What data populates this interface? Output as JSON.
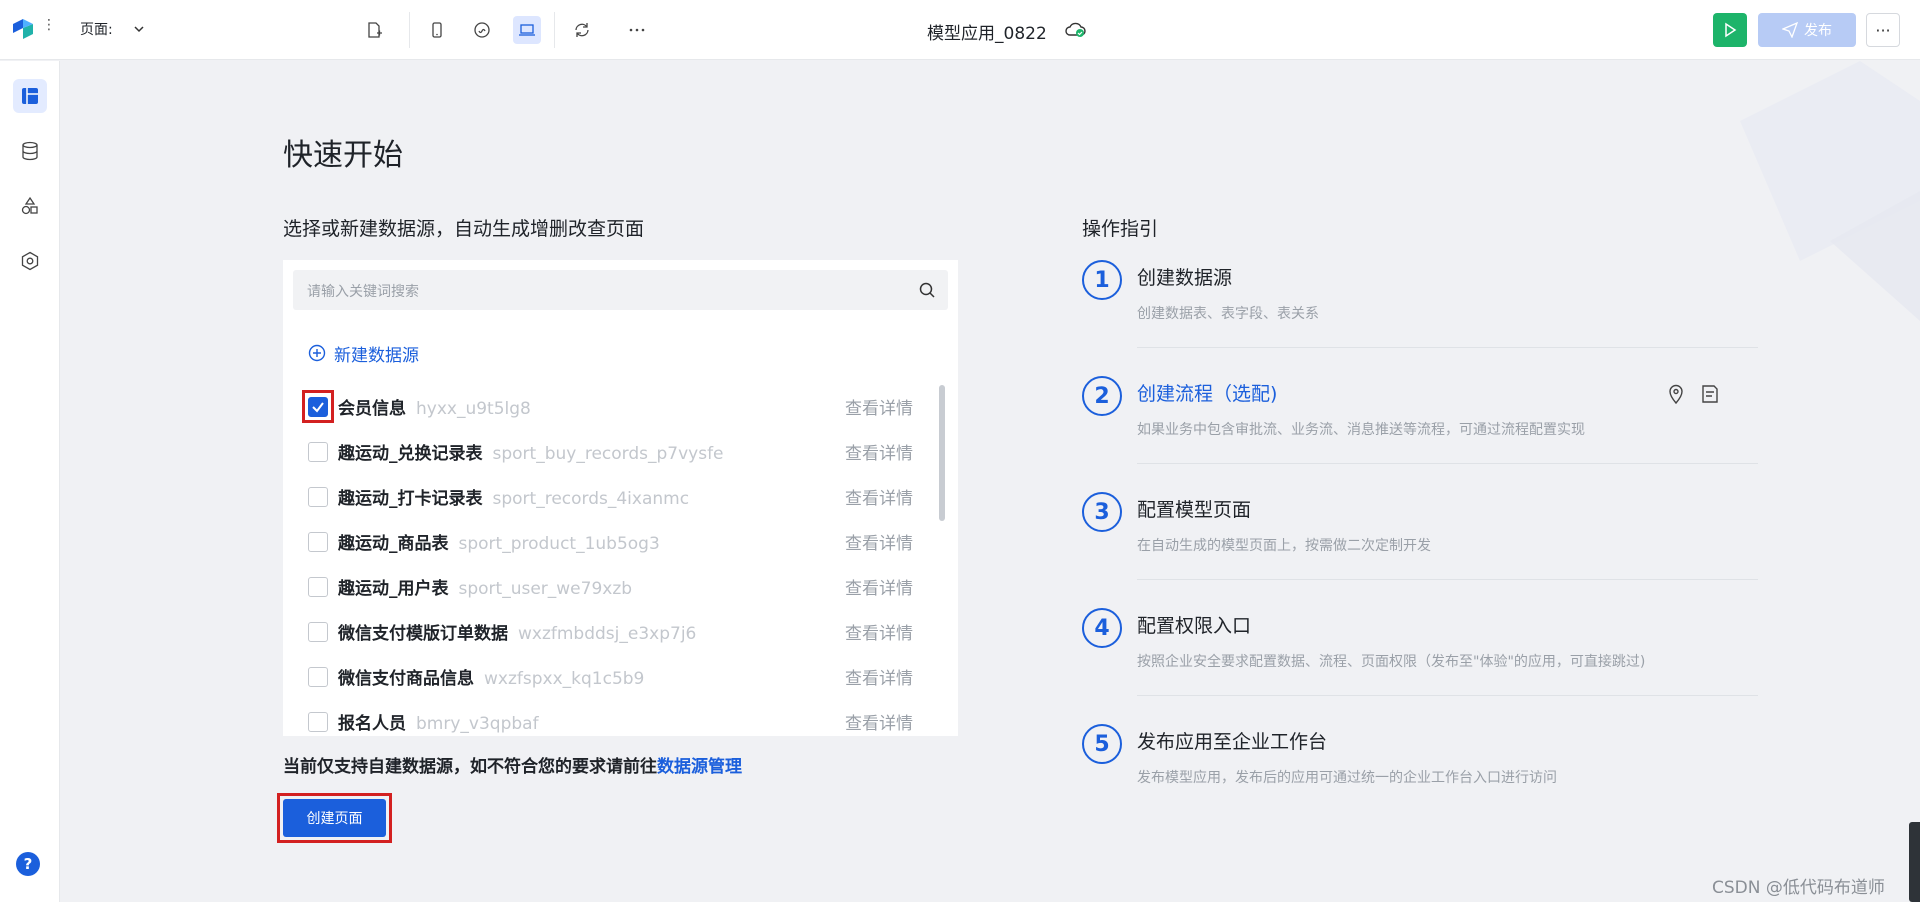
{
  "topbar": {
    "page_label": "页面:",
    "app_title": "模型应用_0822",
    "publish_label": "发布",
    "more_label": "···",
    "colors": {
      "run": "#1db46a",
      "publish": "#b7cbf5",
      "accent": "#1b5fdc"
    }
  },
  "siderail": {
    "items": [
      "page-icon",
      "database-icon",
      "components-icon",
      "settings-hex-icon"
    ],
    "help_label": "?"
  },
  "main": {
    "title": "快速开始",
    "subtitle": "选择或新建数据源，自动生成增删改查页面",
    "search_placeholder": "请输入关键词搜索",
    "new_datasource": "新建数据源",
    "datasources": [
      {
        "name": "会员信息",
        "id": "hyxx_u9t5lg8",
        "detail": "查看详情",
        "checked": true
      },
      {
        "name": "趣运动_兑换记录表",
        "id": "sport_buy_records_p7vysfe",
        "detail": "查看详情",
        "checked": false
      },
      {
        "name": "趣运动_打卡记录表",
        "id": "sport_records_4ixanmc",
        "detail": "查看详情",
        "checked": false
      },
      {
        "name": "趣运动_商品表",
        "id": "sport_product_1ub5og3",
        "detail": "查看详情",
        "checked": false
      },
      {
        "name": "趣运动_用户表",
        "id": "sport_user_we79xzb",
        "detail": "查看详情",
        "checked": false
      },
      {
        "name": "微信支付模版订单数据",
        "id": "wxzfmbddsj_e3xp7j6",
        "detail": "查看详情",
        "checked": false
      },
      {
        "name": "微信支付商品信息",
        "id": "wxzfspxx_kq1c5b9",
        "detail": "查看详情",
        "checked": false
      },
      {
        "name": "报名人员",
        "id": "bmry_v3qpbaf",
        "detail": "查看详情",
        "checked": false
      }
    ],
    "note_text": "当前仅支持自建数据源，如不符合您的要求请前往",
    "note_link": "数据源管理",
    "create_button": "创建页面"
  },
  "guide": {
    "title": "操作指引",
    "steps": [
      {
        "num": "1",
        "title": "创建数据源",
        "desc": "创建数据表、表字段、表关系"
      },
      {
        "num": "2",
        "title": "创建流程（选配)",
        "desc": "如果业务中包含审批流、业务流、消息推送等流程，可通过流程配置实现"
      },
      {
        "num": "3",
        "title": "配置模型页面",
        "desc": "在自动生成的模型页面上，按需做二次定制开发"
      },
      {
        "num": "4",
        "title": "配置权限入口",
        "desc": "按照企业安全要求配置数据、流程、页面权限（发布至\"体验\"的应用，可直接跳过)"
      },
      {
        "num": "5",
        "title": "发布应用至企业工作台",
        "desc": "发布模型应用，发布后的应用可通过统一的企业工作台入口进行访问"
      }
    ]
  },
  "watermark": "CSDN @低代码布道师"
}
